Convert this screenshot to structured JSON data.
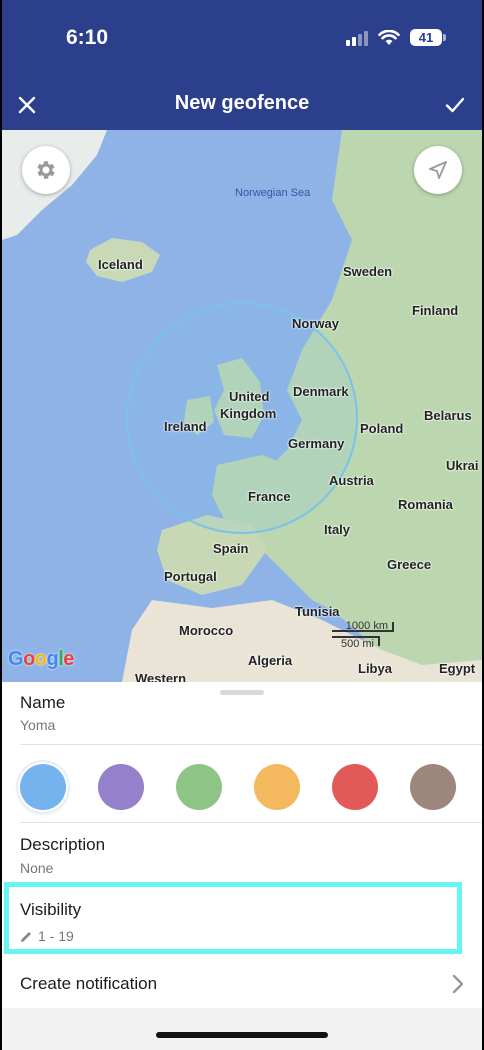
{
  "status_bar": {
    "time": "6:10",
    "battery": "41",
    "icons": [
      "signal-icon",
      "wifi-icon",
      "battery-icon"
    ]
  },
  "nav": {
    "title": "New geofence",
    "close_icon": "close-icon",
    "confirm_icon": "checkmark-icon"
  },
  "map": {
    "settings_icon": "gear-icon",
    "locate_icon": "navigation-arrow-icon",
    "sea_label": "Norwegian Sea",
    "labels": [
      "Iceland",
      "Sweden",
      "Finland",
      "Norway",
      "United",
      "Kingdom",
      "Denmark",
      "Ireland",
      "Belarus",
      "Poland",
      "Germany",
      "Ukrai",
      "Austria",
      "France",
      "Romania",
      "Italy",
      "Spain",
      "Greece",
      "Portugal",
      "Tunisia",
      "Morocco",
      "Algeria",
      "Libya",
      "Egypt",
      "Western"
    ],
    "attribution": "Google",
    "scale_km": "1000 km",
    "scale_mi": "500 mi",
    "accent_color": "#7bc2ea"
  },
  "sheet": {
    "name_label": "Name",
    "name_value": "Yoma",
    "colors": [
      "#75b3ee",
      "#9580cb",
      "#8fc487",
      "#f4b85e",
      "#e15a57",
      "#9d877d"
    ],
    "selected_color_index": 0,
    "description_label": "Description",
    "description_value": "None",
    "visibility_label": "Visibility",
    "visibility_value": "1 - 19",
    "visibility_icon": "pencil-icon",
    "notification_label": "Create notification",
    "notification_icon": "chevron-right-icon",
    "highlight_color": "#66f5f5"
  }
}
